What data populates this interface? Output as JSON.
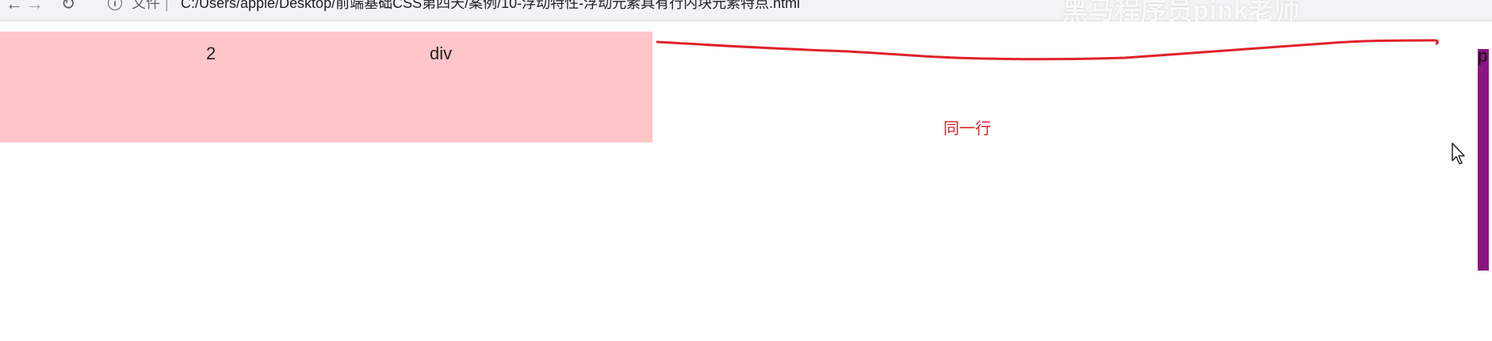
{
  "browser": {
    "scheme_label": "文件",
    "url": "C:/Users/apple/Desktop/前端基础CSS第四天/案例/10-浮动特性-浮动元素具有行内块元素特点.html",
    "watermark": "黑马程序员pink老师"
  },
  "page": {
    "pink_box": {
      "text_number": "2",
      "text_div": "div"
    },
    "annotation": "同一行",
    "purple_box_letter": "p"
  },
  "colors": {
    "pink": "#ffc5c8",
    "annotation_red": "#e0222b",
    "purple": "#8b1582"
  }
}
